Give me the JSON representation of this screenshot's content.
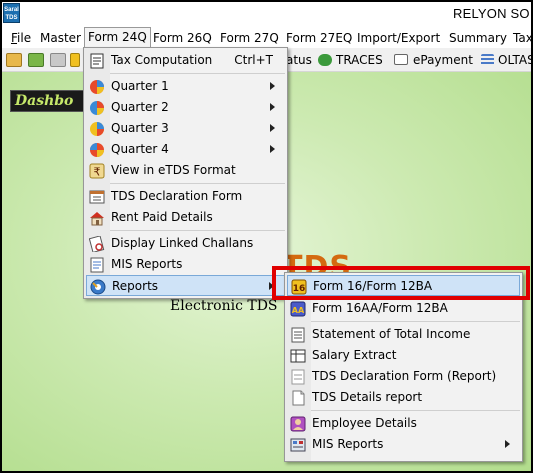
{
  "title_bar": {
    "logo_text": "Saral TDS",
    "app_title": "RELYON SO"
  },
  "menubar": {
    "items": [
      {
        "label": "File",
        "accel": "F",
        "rest": "ile"
      },
      {
        "label": "Master",
        "accel": "",
        "rest": "Master"
      },
      {
        "label": "Form 24Q",
        "accel": "",
        "rest": "Form 24Q"
      },
      {
        "label": "Form 26Q",
        "accel": "",
        "rest": "Form 26Q"
      },
      {
        "label": "Form 27Q",
        "accel": "",
        "rest": "Form 27Q"
      },
      {
        "label": "Form 27EQ",
        "accel": "",
        "rest": "Form 27EQ"
      },
      {
        "label": "Import/Export",
        "accel": "",
        "rest": "Import/Export"
      },
      {
        "label": "Summary",
        "accel": "",
        "rest": "Summary"
      },
      {
        "label": "Tax",
        "accel": "",
        "rest": "Tax"
      }
    ]
  },
  "toolbar": {
    "status_label": "atus",
    "traces_label": "TRACES",
    "epayment_label": "ePayment",
    "oltas_label": "OLTAS"
  },
  "dashboard": {
    "button_label": "Dashbo",
    "brand_text": "TDS",
    "subtitle": "Electronic TDS"
  },
  "form24q_menu": {
    "items": [
      {
        "label": "Tax Computation",
        "shortcut": "Ctrl+T"
      },
      {
        "label": "Quarter 1"
      },
      {
        "label": "Quarter 2"
      },
      {
        "label": "Quarter 3"
      },
      {
        "label": "Quarter 4"
      },
      {
        "label": "View in eTDS Format"
      },
      {
        "label": "TDS Declaration Form"
      },
      {
        "label": "Rent Paid Details"
      },
      {
        "label": "Display Linked Challans"
      },
      {
        "label": "MIS Reports"
      },
      {
        "label": "Reports"
      }
    ]
  },
  "reports_menu": {
    "items": [
      {
        "label": "Form 16/Form 12BA",
        "icon_text": "16"
      },
      {
        "label": "Form 16AA/Form 12BA",
        "icon_text": "AA"
      },
      {
        "label": "Statement of Total Income"
      },
      {
        "label": "Salary Extract"
      },
      {
        "label": "TDS Declaration Form (Report)"
      },
      {
        "label": "TDS Details report"
      },
      {
        "label": "Employee Details"
      },
      {
        "label": "MIS Reports"
      }
    ]
  },
  "colors": {
    "highlight": "#cfe3f7",
    "annotation_red": "#e00000",
    "brand_orange": "#d46a10"
  }
}
